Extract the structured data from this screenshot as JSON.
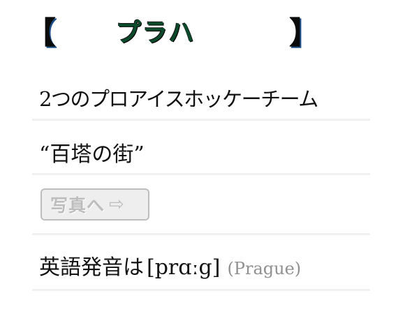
{
  "title": {
    "open_bracket": "【",
    "text": "プラハ",
    "close_bracket": "】"
  },
  "facts": [
    {
      "text": "2つのプロアイスホッケーチーム"
    },
    {
      "text": "“百塔の街”"
    }
  ],
  "photo_button": {
    "label": "写真へ",
    "arrow": "⇨"
  },
  "pronunciation": {
    "label": "英語発音は",
    "ipa": "[prɑːg]",
    "english": "(Prague)"
  },
  "colors": {
    "title": "#0c4a2c",
    "bracket_shadow": "#1e4f88",
    "divider": "#f0f0f0",
    "button_text": "#bdbdbd",
    "english_text": "#909090"
  }
}
